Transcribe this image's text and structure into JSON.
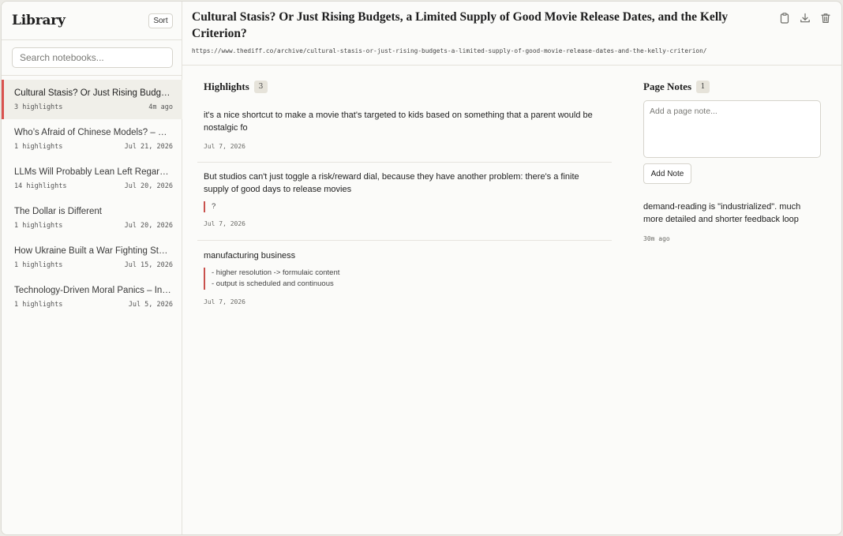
{
  "sidebar": {
    "title": "Library",
    "sort_label": "Sort",
    "search_placeholder": "Search notebooks...",
    "notebooks": [
      {
        "title": "Cultural Stasis? Or Just Rising Budgets, a Limited Supply of Good Movie Release Dates, and the Kelly Criterion?",
        "count": "3 highlights",
        "date": "4m ago"
      },
      {
        "title": "Who’s Afraid of Chinese Models? – Stratechery by Ben Thompson",
        "count": "1 highlights",
        "date": "Jul 21, 2026"
      },
      {
        "title": "LLMs Will Probably Lean Left Regardless",
        "count": "14 highlights",
        "date": "Jul 20, 2026"
      },
      {
        "title": "The Dollar is Different",
        "count": "1 highlights",
        "date": "Jul 20, 2026"
      },
      {
        "title": "How Ukraine Built a War Fighting Stat...",
        "count": "1 highlights",
        "date": "Jul 15, 2026"
      },
      {
        "title": "Technology-Driven Moral Panics – Interconnected",
        "count": "1 highlights",
        "date": "Jul 5, 2026"
      }
    ]
  },
  "page": {
    "title": "Cultural Stasis? Or Just Rising Budgets, a Limited Supply of Good Movie Release Dates, and the Kelly Criterion?",
    "url": "https://www.thediff.co/archive/cultural-stasis-or-just-rising-budgets-a-limited-supply-of-good-movie-release-dates-and-the-kelly-criterion/",
    "icons": [
      "clipboard-icon",
      "download-icon",
      "trash-icon"
    ]
  },
  "highlights": {
    "heading": "Highlights",
    "count": "3",
    "items": [
      {
        "text": "it's a nice shortcut to make a movie that's targeted to kids based on something that a parent would be nostalgic fo",
        "note": [],
        "date": "Jul 7, 2026"
      },
      {
        "text": "But studios can't just toggle a risk/reward dial, because they have another problem: there's a finite supply of good days to release movies",
        "note": [
          "?"
        ],
        "date": "Jul 7, 2026"
      },
      {
        "text": "manufacturing business",
        "note": [
          "- higher resolution -> formulaic content",
          "- output is scheduled and continuous"
        ],
        "date": "Jul 7, 2026"
      }
    ]
  },
  "page_notes": {
    "heading": "Page Notes",
    "count": "1",
    "input_placeholder": "Add a page note...",
    "add_label": "Add Note",
    "notes": [
      {
        "text": "demand-reading is \"industrialized\". much more detailed and shorter feedback loop",
        "time": "30m ago"
      }
    ]
  },
  "colors": {
    "accent": "#d9534f",
    "background": "#fbfbf9",
    "badge": "#e6e3da"
  }
}
